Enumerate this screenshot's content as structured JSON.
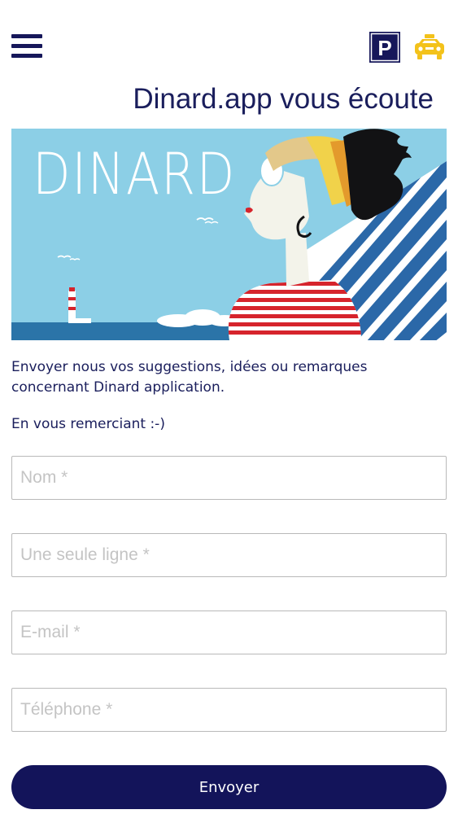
{
  "header": {
    "menu_icon": "hamburger-menu-icon",
    "parking_icon": "parking-icon",
    "parking_glyph": "P",
    "taxi_icon": "taxi-icon",
    "title": "Dinard.app vous écoute"
  },
  "banner": {
    "text": "DINARD",
    "colors": {
      "sky": "#8ccfe6",
      "sea": "#2b74a8",
      "navy": "#15195c",
      "red": "#d6242c",
      "yellow": "#f1d24a"
    }
  },
  "intro": {
    "text": "Envoyer nous vos suggestions, idées ou remarques concernant Dinard application.",
    "thanks": "En vous remerciant :-)"
  },
  "form": {
    "name_placeholder": "Nom *",
    "subject_placeholder": "Une seule ligne *",
    "email_placeholder": "E-mail *",
    "phone_placeholder": "Téléphone *",
    "submit_label": "Envoyer"
  },
  "colors": {
    "primary": "#13145a",
    "title_text": "#1a1e5c",
    "taxi_yellow": "#f3c21b",
    "field_border": "#b9b9b9"
  }
}
